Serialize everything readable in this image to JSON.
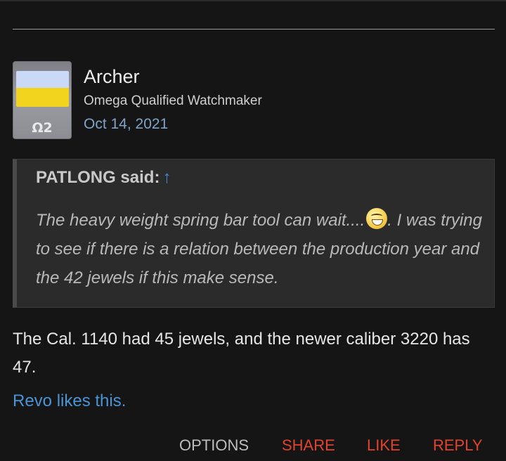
{
  "post": {
    "author": "Archer",
    "author_title": "Omega Qualified Watchmaker",
    "date": "Oct 14, 2021",
    "avatar_badge": "Ω2",
    "avatar_flag_colors": [
      "#cad9f7",
      "#f2d41f"
    ],
    "quote": {
      "author_label": "PATLONG said:",
      "jump_icon": "↑",
      "text_before": "The heavy weight spring bar tool can wait....",
      "emoji": "laughing-smiley",
      "text_after": ". I was trying to see if there is a relation between the production year and the 42 jewels if this make sense."
    },
    "body": "The Cal. 1140 had 45 jewels, and the newer caliber 3220 has 47.",
    "likes": {
      "liker": "Revo",
      "suffix": " likes this."
    }
  },
  "actions": {
    "options": "OPTIONS",
    "share": "SHARE",
    "like": "LIKE",
    "reply": "REPLY"
  },
  "colors": {
    "background": "#151516",
    "accent_link": "#4a93d5",
    "action_red": "#e2432d",
    "quote_bg": "#2b2b2c"
  }
}
